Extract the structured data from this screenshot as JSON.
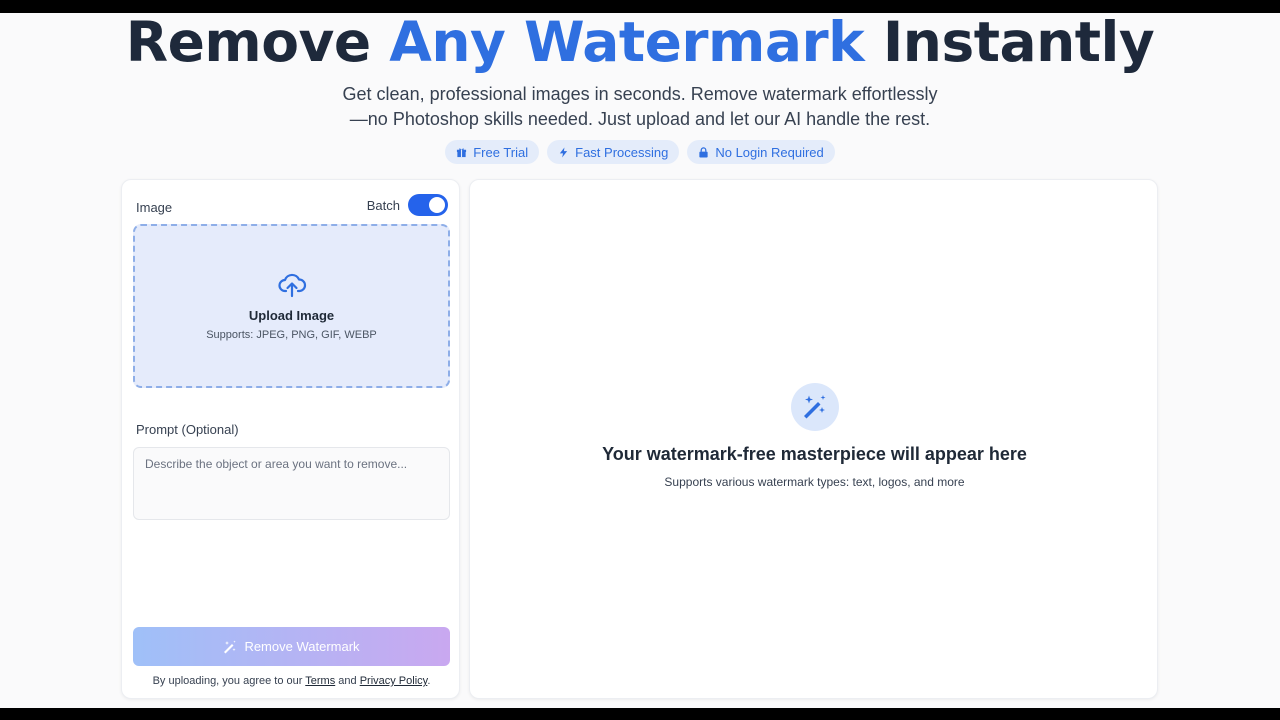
{
  "hero": {
    "title_part1": "Remove ",
    "title_accent": "Any Watermark",
    "title_part2": " Instantly",
    "subtitle_line1": "Get clean, professional images in seconds. Remove watermark effortlessly",
    "subtitle_line2": "—no Photoshop skills needed. Just upload and let our AI handle the rest.",
    "accent_color": "#2f6fe0"
  },
  "chips": [
    {
      "label": "Free Trial",
      "icon": "gift-icon"
    },
    {
      "label": "Fast Processing",
      "icon": "lightning-icon"
    },
    {
      "label": "No Login Required",
      "icon": "lock-icon"
    }
  ],
  "left_panel": {
    "image_label": "Image",
    "batch_label": "Batch",
    "batch_enabled": true,
    "upload_title": "Upload Image",
    "upload_formats": "Supports: JPEG, PNG, GIF, WEBP",
    "prompt_label": "Prompt (Optional)",
    "prompt_placeholder": "Describe the object or area you want to remove...",
    "prompt_value": "",
    "remove_button_label": "Remove Watermark",
    "terms_prefix": "By uploading, you agree to our ",
    "terms_link": "Terms",
    "terms_and": " and ",
    "privacy_link": "Privacy Policy",
    "terms_suffix": "."
  },
  "right_panel": {
    "empty_title": "Your watermark-free masterpiece will appear here",
    "empty_sub": "Supports various watermark types: text, logos, and more"
  },
  "colors": {
    "brand_blue": "#2563eb",
    "chip_bg": "#e4ecfa",
    "dropzone_bg": "#e5ebfb"
  }
}
